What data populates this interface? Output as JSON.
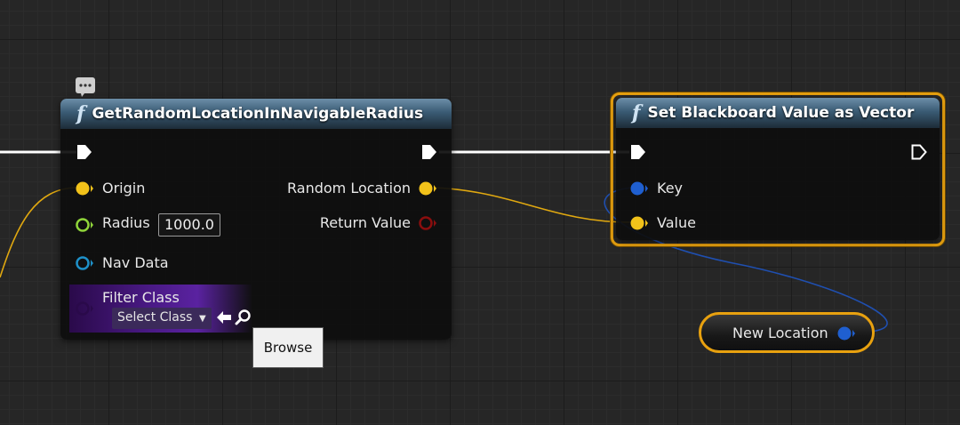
{
  "graph": {
    "comment_icon": "speech-bubble-icon"
  },
  "node_get_random": {
    "icon": "function-icon",
    "title": "GetRandomLocationInNavigableRadius",
    "inputs": {
      "origin": "Origin",
      "radius": "Radius",
      "radius_value": "1000.0",
      "nav_data": "Nav Data",
      "filter_class": "Filter Class",
      "filter_select": "Select Class"
    },
    "outputs": {
      "random_location": "Random Location",
      "return_value": "Return Value"
    }
  },
  "tooltip": {
    "text": "Browse"
  },
  "node_set_blackboard": {
    "icon": "function-icon",
    "title": "Set Blackboard Value as Vector",
    "inputs": {
      "key": "Key",
      "value": "Value"
    }
  },
  "node_new_location": {
    "label": "New Location"
  },
  "colors": {
    "vector_pin": "#f2c21a",
    "float_pin": "#8fd43a",
    "object_pin": "#1e90c8",
    "class_pin": "#5b1fa0",
    "bool_pin": "#8a0e0e",
    "key_pin": "#1f5fd0",
    "selection": "#e8a10f",
    "exec_wire": "#ffffff",
    "vector_wire": "#e0a810",
    "key_wire": "#1f4fb0"
  }
}
